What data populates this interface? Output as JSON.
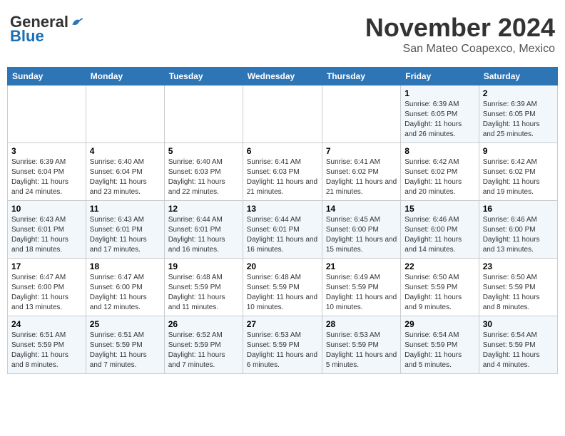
{
  "header": {
    "logo_general": "General",
    "logo_blue": "Blue",
    "month_title": "November 2024",
    "location": "San Mateo Coapexco, Mexico"
  },
  "days_of_week": [
    "Sunday",
    "Monday",
    "Tuesday",
    "Wednesday",
    "Thursday",
    "Friday",
    "Saturday"
  ],
  "weeks": [
    [
      {
        "day": "",
        "info": ""
      },
      {
        "day": "",
        "info": ""
      },
      {
        "day": "",
        "info": ""
      },
      {
        "day": "",
        "info": ""
      },
      {
        "day": "",
        "info": ""
      },
      {
        "day": "1",
        "info": "Sunrise: 6:39 AM\nSunset: 6:05 PM\nDaylight: 11 hours and 26 minutes."
      },
      {
        "day": "2",
        "info": "Sunrise: 6:39 AM\nSunset: 6:05 PM\nDaylight: 11 hours and 25 minutes."
      }
    ],
    [
      {
        "day": "3",
        "info": "Sunrise: 6:39 AM\nSunset: 6:04 PM\nDaylight: 11 hours and 24 minutes."
      },
      {
        "day": "4",
        "info": "Sunrise: 6:40 AM\nSunset: 6:04 PM\nDaylight: 11 hours and 23 minutes."
      },
      {
        "day": "5",
        "info": "Sunrise: 6:40 AM\nSunset: 6:03 PM\nDaylight: 11 hours and 22 minutes."
      },
      {
        "day": "6",
        "info": "Sunrise: 6:41 AM\nSunset: 6:03 PM\nDaylight: 11 hours and 21 minutes."
      },
      {
        "day": "7",
        "info": "Sunrise: 6:41 AM\nSunset: 6:02 PM\nDaylight: 11 hours and 21 minutes."
      },
      {
        "day": "8",
        "info": "Sunrise: 6:42 AM\nSunset: 6:02 PM\nDaylight: 11 hours and 20 minutes."
      },
      {
        "day": "9",
        "info": "Sunrise: 6:42 AM\nSunset: 6:02 PM\nDaylight: 11 hours and 19 minutes."
      }
    ],
    [
      {
        "day": "10",
        "info": "Sunrise: 6:43 AM\nSunset: 6:01 PM\nDaylight: 11 hours and 18 minutes."
      },
      {
        "day": "11",
        "info": "Sunrise: 6:43 AM\nSunset: 6:01 PM\nDaylight: 11 hours and 17 minutes."
      },
      {
        "day": "12",
        "info": "Sunrise: 6:44 AM\nSunset: 6:01 PM\nDaylight: 11 hours and 16 minutes."
      },
      {
        "day": "13",
        "info": "Sunrise: 6:44 AM\nSunset: 6:01 PM\nDaylight: 11 hours and 16 minutes."
      },
      {
        "day": "14",
        "info": "Sunrise: 6:45 AM\nSunset: 6:00 PM\nDaylight: 11 hours and 15 minutes."
      },
      {
        "day": "15",
        "info": "Sunrise: 6:46 AM\nSunset: 6:00 PM\nDaylight: 11 hours and 14 minutes."
      },
      {
        "day": "16",
        "info": "Sunrise: 6:46 AM\nSunset: 6:00 PM\nDaylight: 11 hours and 13 minutes."
      }
    ],
    [
      {
        "day": "17",
        "info": "Sunrise: 6:47 AM\nSunset: 6:00 PM\nDaylight: 11 hours and 13 minutes."
      },
      {
        "day": "18",
        "info": "Sunrise: 6:47 AM\nSunset: 6:00 PM\nDaylight: 11 hours and 12 minutes."
      },
      {
        "day": "19",
        "info": "Sunrise: 6:48 AM\nSunset: 5:59 PM\nDaylight: 11 hours and 11 minutes."
      },
      {
        "day": "20",
        "info": "Sunrise: 6:48 AM\nSunset: 5:59 PM\nDaylight: 11 hours and 10 minutes."
      },
      {
        "day": "21",
        "info": "Sunrise: 6:49 AM\nSunset: 5:59 PM\nDaylight: 11 hours and 10 minutes."
      },
      {
        "day": "22",
        "info": "Sunrise: 6:50 AM\nSunset: 5:59 PM\nDaylight: 11 hours and 9 minutes."
      },
      {
        "day": "23",
        "info": "Sunrise: 6:50 AM\nSunset: 5:59 PM\nDaylight: 11 hours and 8 minutes."
      }
    ],
    [
      {
        "day": "24",
        "info": "Sunrise: 6:51 AM\nSunset: 5:59 PM\nDaylight: 11 hours and 8 minutes."
      },
      {
        "day": "25",
        "info": "Sunrise: 6:51 AM\nSunset: 5:59 PM\nDaylight: 11 hours and 7 minutes."
      },
      {
        "day": "26",
        "info": "Sunrise: 6:52 AM\nSunset: 5:59 PM\nDaylight: 11 hours and 7 minutes."
      },
      {
        "day": "27",
        "info": "Sunrise: 6:53 AM\nSunset: 5:59 PM\nDaylight: 11 hours and 6 minutes."
      },
      {
        "day": "28",
        "info": "Sunrise: 6:53 AM\nSunset: 5:59 PM\nDaylight: 11 hours and 5 minutes."
      },
      {
        "day": "29",
        "info": "Sunrise: 6:54 AM\nSunset: 5:59 PM\nDaylight: 11 hours and 5 minutes."
      },
      {
        "day": "30",
        "info": "Sunrise: 6:54 AM\nSunset: 5:59 PM\nDaylight: 11 hours and 4 minutes."
      }
    ]
  ]
}
